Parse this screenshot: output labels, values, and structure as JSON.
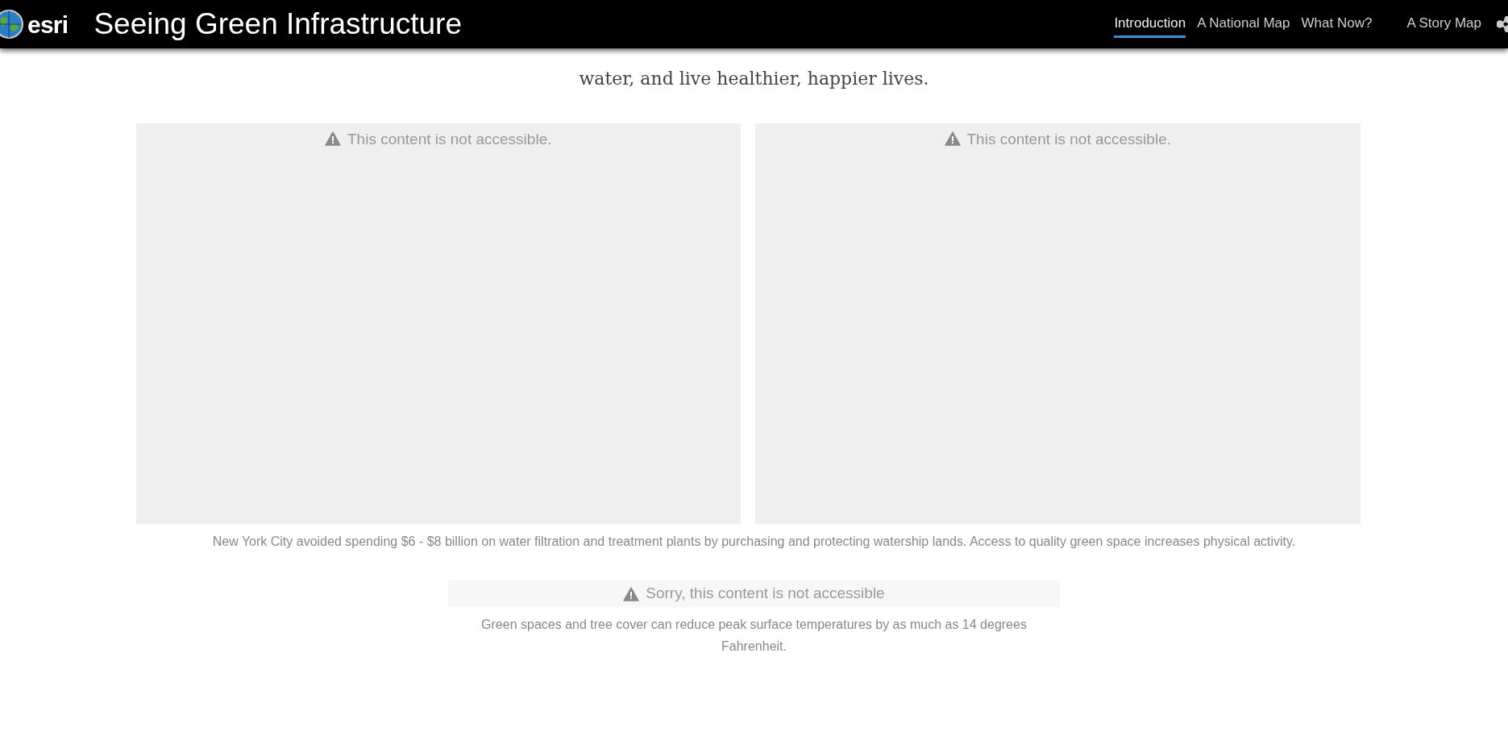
{
  "header": {
    "logo": "esri",
    "title": "Seeing Green Infrastructure",
    "nav": [
      {
        "label": "Introduction",
        "selected": true
      },
      {
        "label": "A National Map",
        "selected": false
      },
      {
        "label": "What Now?",
        "selected": false
      },
      {
        "label": "A Story Map",
        "selected": false
      }
    ]
  },
  "intro": "water, and live healthier, happier lives.",
  "panels": [
    {
      "message": "This content is not accessible."
    },
    {
      "message": "This content is not accessible."
    }
  ],
  "panels_caption": "New York City avoided spending $6 - $8 billion on water filtration and treatment plants by purchasing and protecting watership lands. Access to quality green space increases physical activity.",
  "notice": {
    "message": "Sorry, this content is not accessible",
    "caption": "Green spaces and tree cover can reduce peak surface temperatures by as much as 14 degrees Fahrenheit."
  }
}
